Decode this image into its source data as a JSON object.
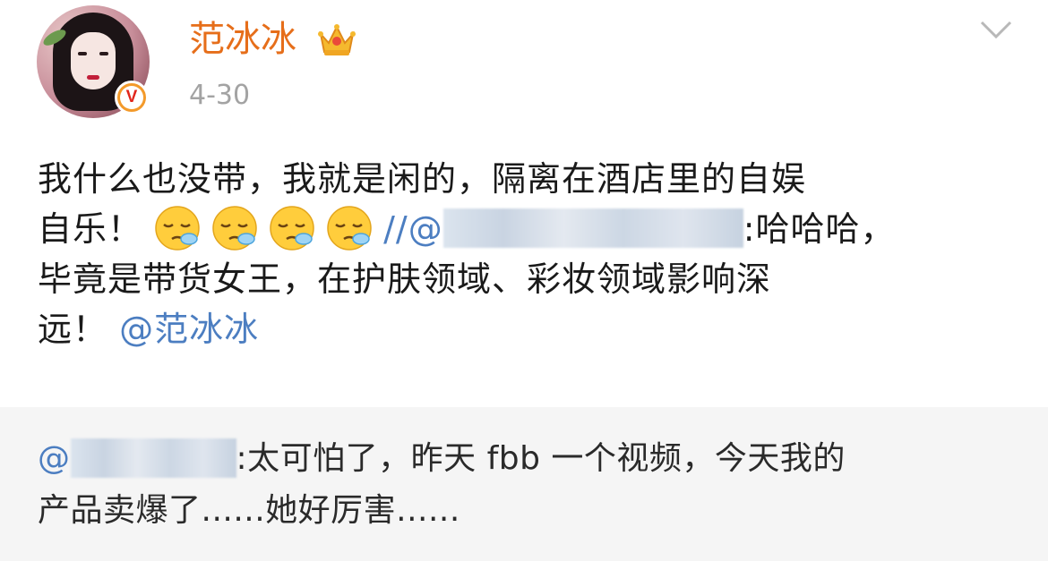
{
  "post": {
    "username": "范冰冰",
    "date": "4-30",
    "verified_badge": "V",
    "icons": [
      "crown-icon",
      "verified-badge-icon",
      "chevron-down-icon",
      "sleepy-emoji-icon"
    ],
    "text": {
      "line1": "我什么也没带，我就是闲的，隔离在酒店里的自娱",
      "line2_prefix": "自乐！",
      "line2_repost_marker": "//@",
      "line2_suffix": ":哈哈哈，",
      "line3": "毕竟是带货女王，在护肤领域、彩妆领域影响深",
      "line4_prefix": "远！",
      "line4_mention": "@范冰冰"
    }
  },
  "repost": {
    "mention_prefix": "@",
    "line1_suffix": ":太可怕了，昨天 fbb 一个视频，今天我的",
    "line2": "产品卖爆了......她好厉害......"
  },
  "colors": {
    "username": "#e66e1a",
    "mention": "#4c7ec1",
    "date": "#a3a3a3",
    "repost_bg": "#f5f5f5"
  }
}
